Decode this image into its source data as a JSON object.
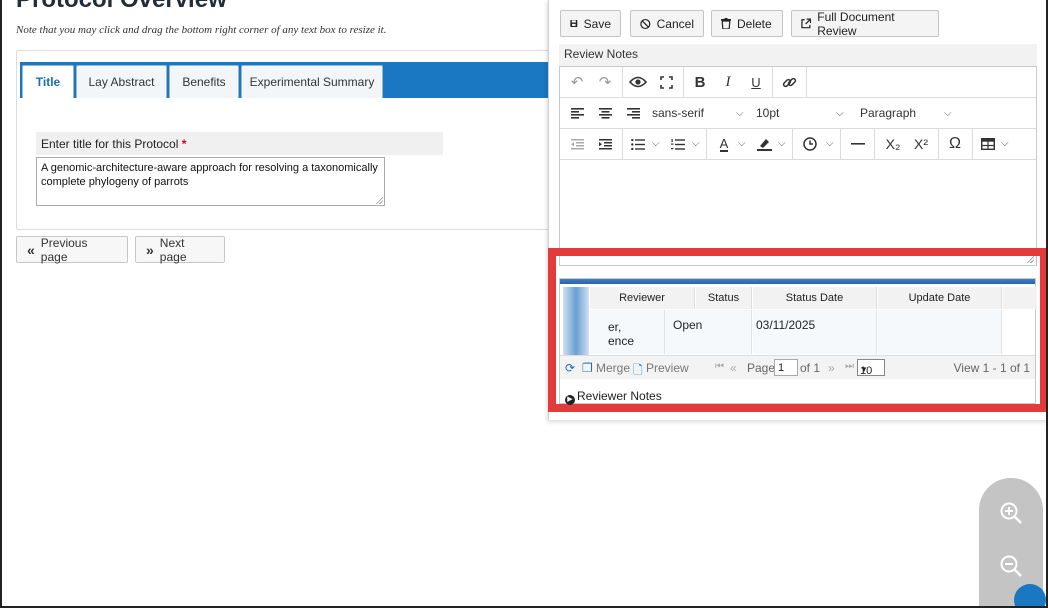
{
  "page": {
    "heading": "Protocol Overview",
    "note": "Note that you may click and drag the bottom right corner of any text box to resize it.",
    "tabs": [
      {
        "label": "Title"
      },
      {
        "label": "Lay Abstract"
      },
      {
        "label": "Benefits"
      },
      {
        "label": "Experimental Summary"
      }
    ],
    "title_field": {
      "label": "Enter title for this Protocol",
      "required_mark": "*",
      "value": "A genomic-architecture-aware approach for resolving a taxonomically complete phylogeny of parrots"
    },
    "prev_label": "Previous page",
    "next_label": "Next page"
  },
  "panel": {
    "toolbar": {
      "save": "Save",
      "cancel": "Cancel",
      "delete": "Delete",
      "full_review": "Full Document Review"
    },
    "review_notes_title": "Review Notes",
    "editor": {
      "font_family": "sans-serif",
      "font_size": "10pt",
      "block_format": "Paragraph",
      "subscript": "X₂",
      "superscript": "X²",
      "omega": "Ω"
    },
    "grid": {
      "columns": [
        "Reviewer",
        "Status",
        "Status Date",
        "Update Date"
      ],
      "rows": [
        {
          "reviewer": "er,",
          "reviewer_line2": "ence",
          "status": "Open",
          "status_date": "03/11/2025",
          "update_date": ""
        }
      ],
      "footer": {
        "merge": "Merge",
        "preview": "Preview",
        "page_label": "Page",
        "page_value": "1",
        "of_label": "of 1",
        "rows_per_page": "10",
        "view_text": "View 1 - 1 of 1"
      },
      "toggle_label": "Reviewer Notes"
    }
  },
  "colors": {
    "tab_bar": "#1a78c2",
    "highlight": "#e33b3b",
    "zoom_bg": "#c4c4c4"
  }
}
